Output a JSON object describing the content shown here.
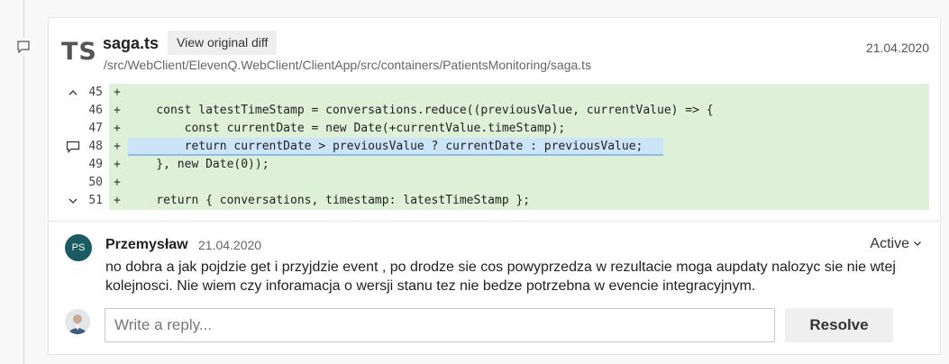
{
  "file": {
    "badge": "TS",
    "name": "saga.ts",
    "view_diff_label": "View original diff",
    "path": "/src/WebClient/ElevenQ.WebClient/ClientApp/src/containers/PatientsMonitoring/saga.ts",
    "date": "21.04.2020"
  },
  "diff": {
    "lines": [
      {
        "num": "45",
        "sign": "+",
        "code": ""
      },
      {
        "num": "46",
        "sign": "+",
        "code": "    const latestTimeStamp = conversations.reduce((previousValue, currentValue) => {"
      },
      {
        "num": "47",
        "sign": "+",
        "code": "        const currentDate = new Date(+currentValue.timeStamp);"
      },
      {
        "num": "48",
        "sign": "+",
        "code": "        return currentDate > previousValue ? currentDate : previousValue;"
      },
      {
        "num": "49",
        "sign": "+",
        "code": "    }, new Date(0));"
      },
      {
        "num": "50",
        "sign": "+",
        "code": ""
      },
      {
        "num": "51",
        "sign": "+",
        "code": "    return { conversations, timestamp: latestTimeStamp };"
      }
    ]
  },
  "comment": {
    "avatar_initials": "PS",
    "author": "Przemysław",
    "date": "21.04.2020",
    "status": "Active",
    "text": "no dobra a jak pojdzie get i przyjdzie event , po drodze sie cos powyprzedza w rezultacie moga aupdaty nalozyc sie nie wtej kolejnosci. Nie wiem czy inforamacja o wersji stanu tez nie bedze potrzebna w evencie integracyjnym."
  },
  "reply": {
    "placeholder": "Write a reply...",
    "resolve_label": "Resolve"
  },
  "colors": {
    "added_line_bg": "#dff0d8",
    "selected_line_bg": "#cce4f7",
    "avatar_bg": "#1a5a63"
  }
}
